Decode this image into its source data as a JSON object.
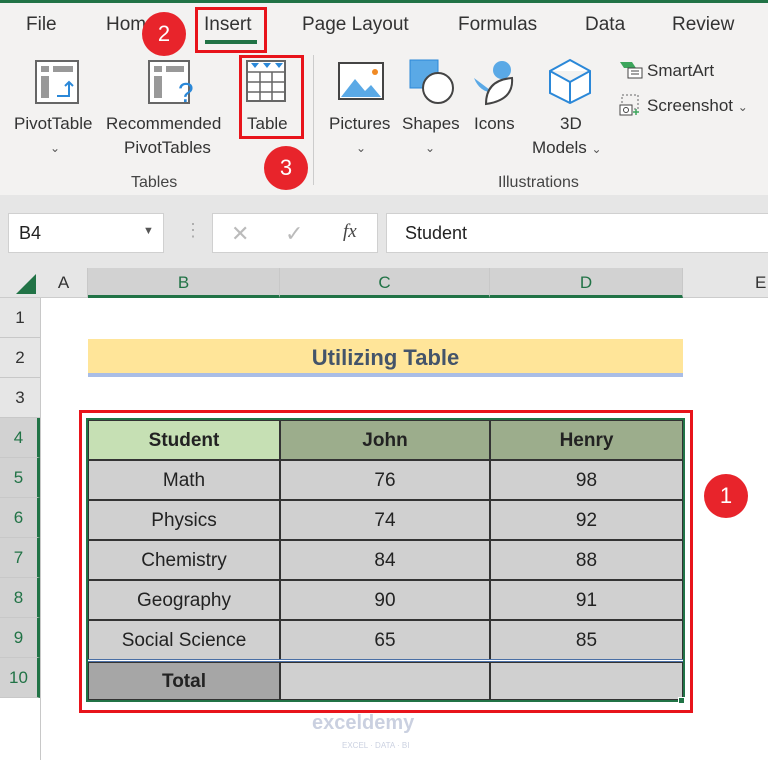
{
  "tabs": [
    "File",
    "Home",
    "Insert",
    "Page Layout",
    "Formulas",
    "Data",
    "Review"
  ],
  "ribbon": {
    "tables_group": "Tables",
    "illustrations_group": "Illustrations",
    "pivot": "PivotTable",
    "rec1": "Recommended",
    "rec2": "PivotTables",
    "table": "Table",
    "pictures": "Pictures",
    "shapes": "Shapes",
    "icons": "Icons",
    "models1": "3D",
    "models2": "Models",
    "smartart": "SmartArt",
    "screenshot": "Screenshot"
  },
  "badges": {
    "one": "1",
    "two": "2",
    "three": "3"
  },
  "formula_bar": {
    "name_box": "B4",
    "value": "Student",
    "fx": "fx"
  },
  "columns": [
    "A",
    "B",
    "C",
    "D",
    "E"
  ],
  "rows": [
    "1",
    "2",
    "3",
    "4",
    "5",
    "6",
    "7",
    "8",
    "9",
    "10"
  ],
  "title": "Utilizing Table",
  "table": {
    "headers": [
      "Student",
      "John",
      "Henry"
    ],
    "rows": [
      [
        "Math",
        "76",
        "98"
      ],
      [
        "Physics",
        "74",
        "92"
      ],
      [
        "Chemistry",
        "84",
        "88"
      ],
      [
        "Geography",
        "90",
        "91"
      ],
      [
        "Social Science",
        "65",
        "85"
      ]
    ],
    "total": [
      "Total",
      "",
      ""
    ]
  },
  "watermark": "exceldemy",
  "watermark_sub": "EXCEL · DATA · BI",
  "colors": {
    "accent": "#217346",
    "highlight": "#e8141b",
    "title_bg": "#ffe599",
    "header_bg": "#9cad8c",
    "student_bg": "#c6e0b4"
  }
}
